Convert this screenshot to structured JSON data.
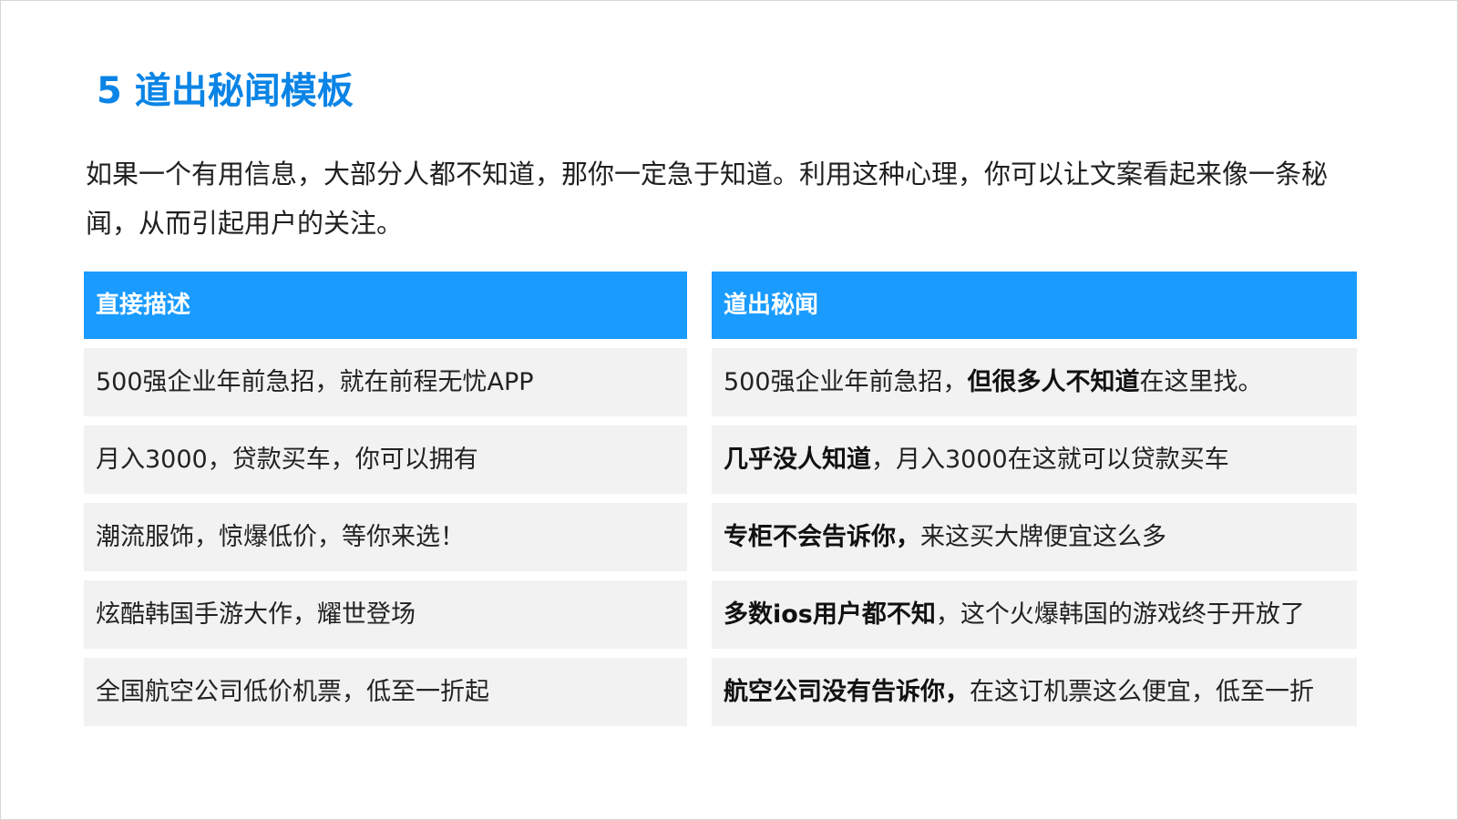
{
  "colors": {
    "accent": "#0a84e6",
    "header_bg": "#1a9bff",
    "cell_bg": "#f2f2f2"
  },
  "title": "5 道出秘闻模板",
  "intro": "如果一个有用信息，大部分人都不知道，那你一定急于知道。利用这种心理，你可以让文案看起来像一条秘闻，从而引起用户的关注。",
  "table": {
    "left_header": "直接描述",
    "right_header": "道出秘闻",
    "left_rows": [
      "500强企业年前急招，就在前程无忧APP",
      "月入3000，贷款买车，你可以拥有",
      "潮流服饰，惊爆低价，等你来选！",
      "炫酷韩国手游大作，耀世登场",
      "全国航空公司低价机票，低至一折起"
    ],
    "right_rows": [
      {
        "pre": "500强企业年前急招，",
        "bold": "但很多人不知道",
        "post": "在这里找。"
      },
      {
        "pre": "",
        "bold": "几乎没人知道",
        "post": "，月入3000在这就可以贷款买车"
      },
      {
        "pre": "",
        "bold": "专柜不会告诉你，",
        "post": "来这买大牌便宜这么多"
      },
      {
        "pre": "",
        "bold": "多数ios用户都不知",
        "post": "，这个火爆韩国的游戏终于开放了"
      },
      {
        "pre": "",
        "bold": "航空公司没有告诉你，",
        "post": "在这订机票这么便宜，低至一折"
      }
    ]
  }
}
